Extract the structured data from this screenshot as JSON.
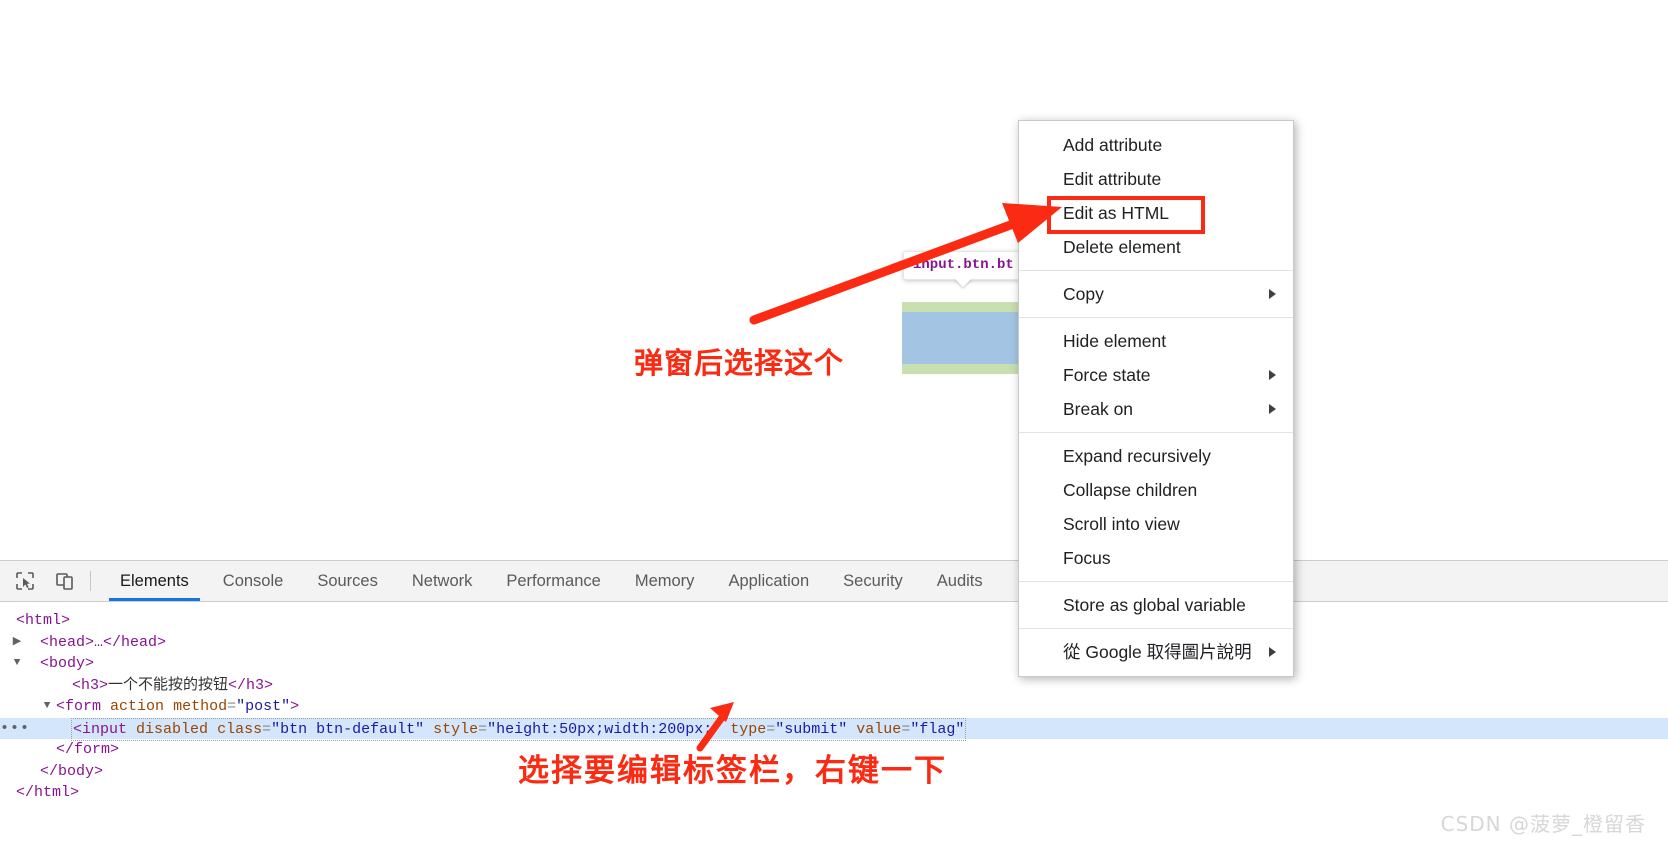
{
  "page": {
    "element_tooltip": "input.btn.bt"
  },
  "annotations": {
    "top": "弹窗后选择这个",
    "bottom": "选择要编辑标签栏，右键一下"
  },
  "context_menu": {
    "items": [
      {
        "label": "Add attribute",
        "submenu": false
      },
      {
        "label": "Edit attribute",
        "submenu": false
      },
      {
        "label": "Edit as HTML",
        "submenu": false,
        "highlighted": true
      },
      {
        "label": "Delete element",
        "submenu": false
      },
      {
        "separator": true
      },
      {
        "label": "Copy",
        "submenu": true
      },
      {
        "separator": true
      },
      {
        "label": "Hide element",
        "submenu": false
      },
      {
        "label": "Force state",
        "submenu": true
      },
      {
        "label": "Break on",
        "submenu": true
      },
      {
        "separator": true
      },
      {
        "label": "Expand recursively",
        "submenu": false
      },
      {
        "label": "Collapse children",
        "submenu": false
      },
      {
        "label": "Scroll into view",
        "submenu": false
      },
      {
        "label": "Focus",
        "submenu": false
      },
      {
        "separator": true
      },
      {
        "label": "Store as global variable",
        "submenu": false
      },
      {
        "separator": true
      },
      {
        "label": "從 Google 取得圖片說明",
        "submenu": true
      }
    ]
  },
  "devtools": {
    "tabs": [
      {
        "label": "Elements",
        "active": true
      },
      {
        "label": "Console",
        "active": false
      },
      {
        "label": "Sources",
        "active": false
      },
      {
        "label": "Network",
        "active": false
      },
      {
        "label": "Performance",
        "active": false
      },
      {
        "label": "Memory",
        "active": false
      },
      {
        "label": "Application",
        "active": false
      },
      {
        "label": "Security",
        "active": false
      },
      {
        "label": "Audits",
        "active": false
      }
    ],
    "dom": {
      "line_html_open": "<html>",
      "line_head": "<head>…</head>",
      "line_body_open": "<body>",
      "h3_open": "<h3>",
      "h3_text": "一个不能按的按钮",
      "h3_close": "</h3>",
      "form_open_tag": "<form",
      "form_attr_action": "action",
      "form_attr_method_name": "method",
      "form_attr_method_value": "\"post\"",
      "form_open_end": ">",
      "input_tag": "<input",
      "input_attr_disabled": "disabled",
      "input_attr_class_name": "class",
      "input_attr_class_value": "\"btn btn-default\"",
      "input_attr_style_name": "style",
      "input_attr_style_value": "\"height:50px;width:200px;\"",
      "input_attr_type_name": "type",
      "input_attr_type_value": "\"submit\"",
      "input_attr_value_name": "value",
      "input_attr_value_value": "\"flag\"",
      "line_form_close": "</form>",
      "line_body_close": "</body>",
      "line_html_close": "</html>",
      "row_dots": "•••",
      "twisty_closed": "▶",
      "twisty_open": "▼"
    }
  },
  "watermark": "CSDN @菠萝_橙留香",
  "colors": {
    "accent_blue": "#1673e6",
    "annotation_red": "#fb2a12",
    "selected_row": "#d4e6fb",
    "highlight_content": "#a3c5e3",
    "highlight_padding": "#c8dfb0"
  }
}
